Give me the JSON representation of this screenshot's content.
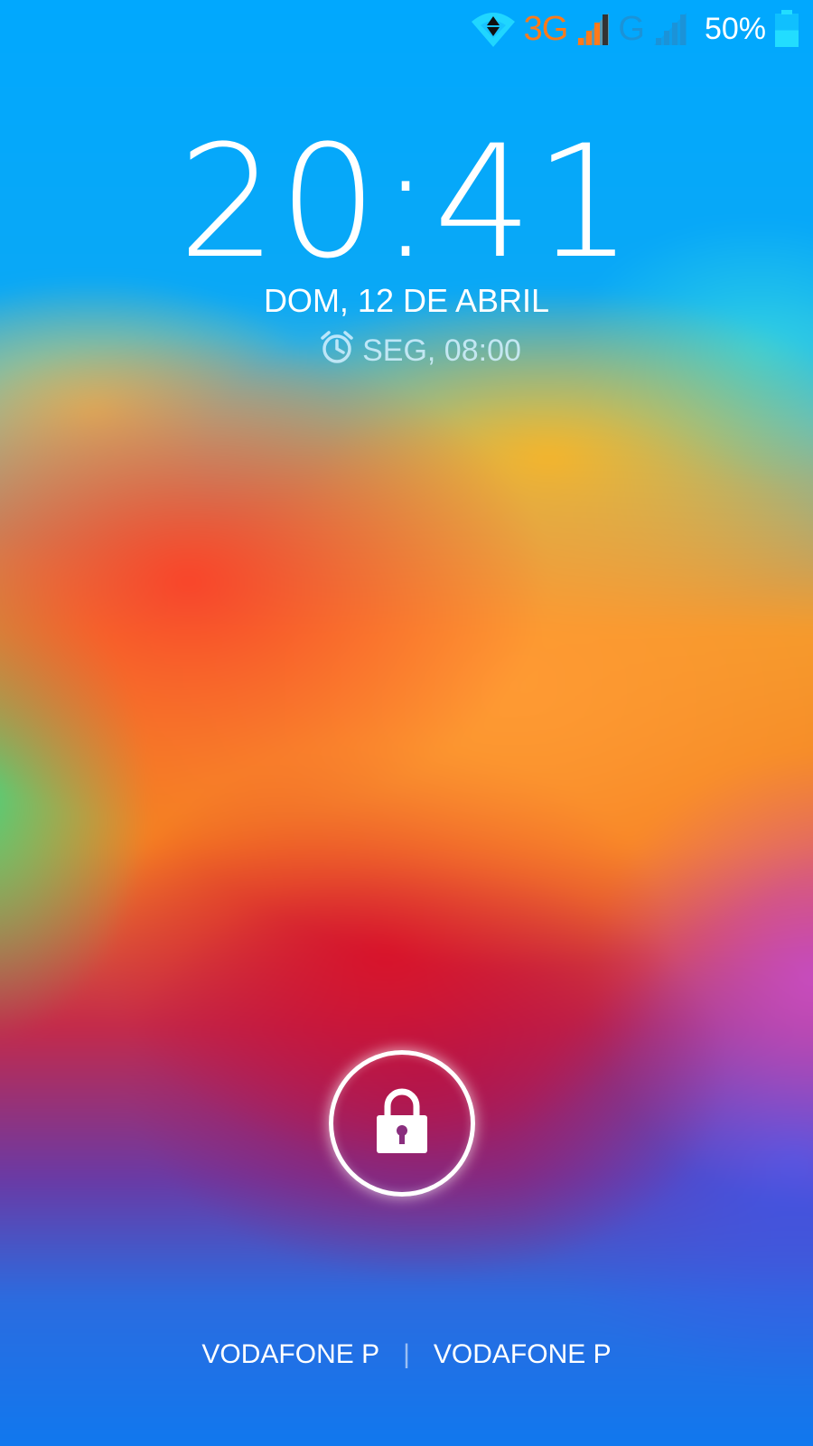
{
  "status_bar": {
    "wifi_icon": "wifi-data-icon",
    "network_1_type": "3G",
    "network_2_type": "G",
    "battery_percent": "50%",
    "battery_level": 0.5,
    "colors": {
      "network_1": "#ff7a1a",
      "network_2": "#1b93d8",
      "battery": "#22ddff"
    }
  },
  "lockscreen": {
    "time": "20:41",
    "date": "DOM, 12 DE ABRIL",
    "alarm_icon": "alarm-clock-icon",
    "alarm_text": "SEG, 08:00",
    "lock_icon": "padlock-icon"
  },
  "carriers": {
    "sim1": "VODAFONE P",
    "separator": "|",
    "sim2": "VODAFONE P"
  }
}
